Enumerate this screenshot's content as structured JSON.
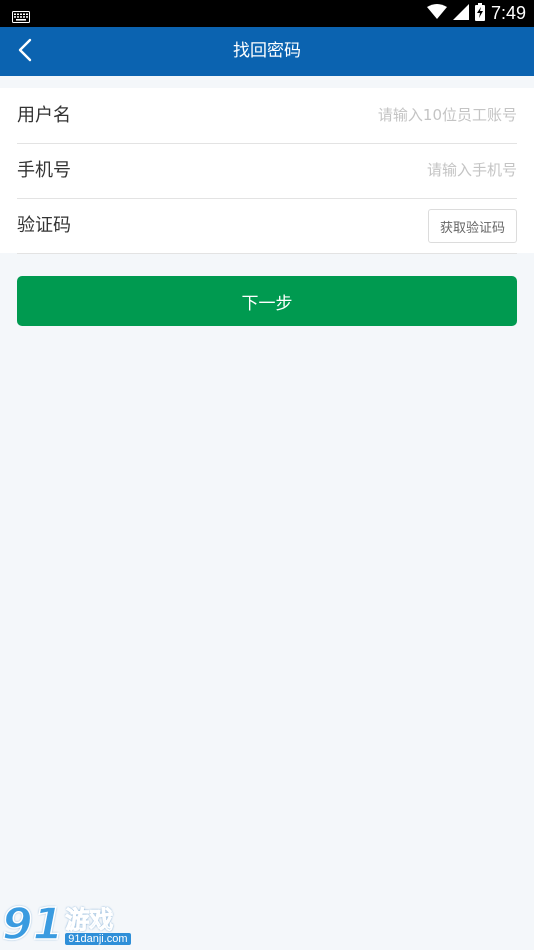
{
  "status_bar": {
    "time": "7:49",
    "icons": [
      "keyboard-icon",
      "wifi-icon",
      "signal-icon",
      "battery-charging-icon"
    ]
  },
  "app_bar": {
    "title": "找回密码",
    "back_icon": "chevron-left-icon"
  },
  "form": {
    "username": {
      "label": "用户名",
      "placeholder": "请输入10位员工账号"
    },
    "phone": {
      "label": "手机号",
      "placeholder": "请输入手机号"
    },
    "code": {
      "label": "验证码",
      "placeholder": "",
      "button_label": "获取验证码"
    }
  },
  "next_button_label": "下一步",
  "watermark": {
    "number": "91",
    "text": "游戏",
    "domain": "91danji.com"
  },
  "colors": {
    "app_bar": "#0b63b0",
    "primary_button": "#009a50",
    "background": "#f4f7fa"
  }
}
